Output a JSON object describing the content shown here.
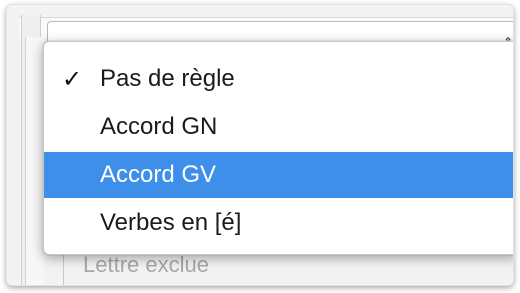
{
  "dropdown": {
    "items": [
      {
        "label": "Pas de règle",
        "checked": true,
        "highlighted": false,
        "check_icon": "checkmark-icon"
      },
      {
        "label": "Accord GN",
        "checked": false,
        "highlighted": false
      },
      {
        "label": "Accord GV",
        "checked": false,
        "highlighted": true
      },
      {
        "label": "Verbes en [é]",
        "checked": false,
        "highlighted": false
      }
    ],
    "check_glyph": "✓"
  },
  "background": {
    "partial_list_item": "Lettre exclue",
    "select_arrow_icon": "up-down-arrows-icon"
  },
  "colors": {
    "highlight": "#3d8fe9",
    "highlight_text": "#ffffff",
    "text": "#1b1b1b",
    "muted_text": "#a9a9a9"
  }
}
